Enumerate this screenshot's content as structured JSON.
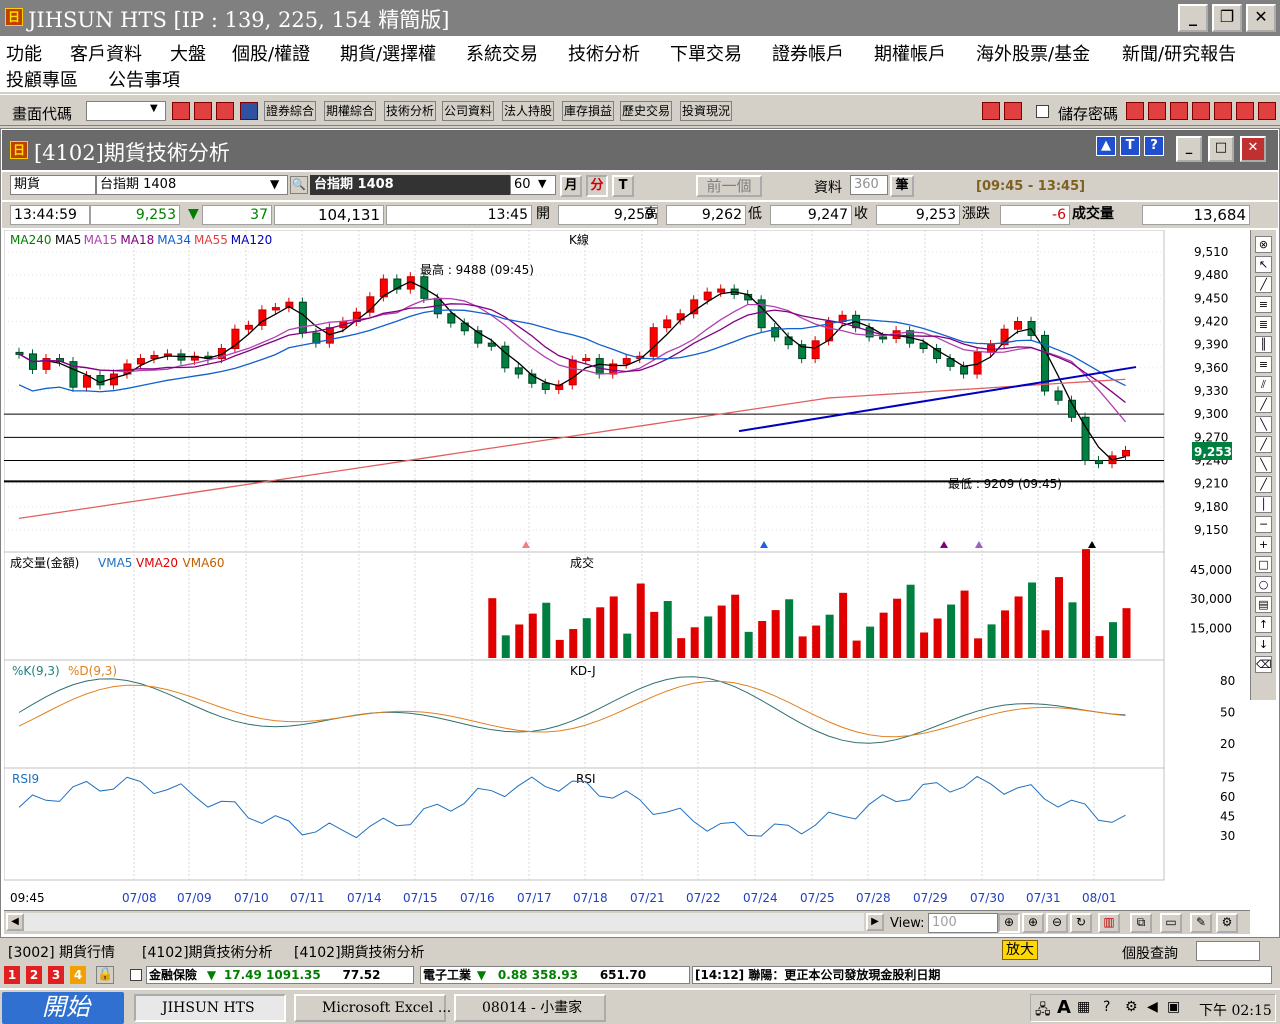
{
  "window": {
    "title": "JIHSUN HTS    [IP : 139, 225, 154 精簡版]",
    "logo": "日"
  },
  "menu": {
    "items": [
      "功能",
      "客戶資料",
      "大盤",
      "個股/權證",
      "期貨/選擇權",
      "系統交易",
      "技術分析",
      "下單交易",
      "證券帳戶",
      "期權帳戶",
      "海外股票/基金",
      "新聞/研究報告",
      "投顧專區",
      "公告事項"
    ]
  },
  "toolbar": {
    "code_label": "畫面代碼",
    "code_value": "",
    "quick_buttons": [
      "證券綜合",
      "期權綜合",
      "技術分析",
      "公司資料",
      "法人持股",
      "庫存損益",
      "歷史交易",
      "投資現況"
    ],
    "save_pwd": "儲存密碼"
  },
  "inner": {
    "title": "[4102]期貨技術分析"
  },
  "selector": {
    "market": "期貨",
    "contract": "台指期 1408",
    "contract_display": "台指期  1408",
    "period": "60",
    "btn_month": "月",
    "btn_min": "分",
    "btn_tick": "T",
    "prev": "前一個",
    "data_label": "資料",
    "data_value": "360",
    "unit": "筆",
    "range": "[09:45 - 13:45]"
  },
  "quote": {
    "time": "13:44:59",
    "price": "9,253",
    "change": "37",
    "total": "104,131",
    "bar_time": "13:45",
    "open_label": "開",
    "open": "9,259",
    "high_label": "高",
    "high": "9,262",
    "low_label": "低",
    "low": "9,247",
    "close_label": "收",
    "close": "9,253",
    "chg_label": "漲跌",
    "chg": "-6",
    "vol_label": "成交量",
    "vol": "13,684"
  },
  "chart_data": [
    {
      "type": "line",
      "title": "K線",
      "legend": [
        "MA240",
        "MA5",
        "MA15",
        "MA18",
        "MA34",
        "MA55",
        "MA120"
      ],
      "colors": {
        "MA240": "#008000",
        "MA5": "#000000",
        "MA15": "#b040b0",
        "MA18": "#800080",
        "MA34": "#1060d0",
        "MA55": "#e04040",
        "MA120": "#0000c0",
        "up": "#ff0000",
        "down": "#008040"
      },
      "ylim": [
        9150,
        9510
      ],
      "y_ticks": [
        "9,510",
        "9,480",
        "9,450",
        "9,420",
        "9,390",
        "9,360",
        "9,330",
        "9,300",
        "9,270",
        "9,240",
        "9,210",
        "9,180",
        "9,150"
      ],
      "high_note": "最高 : 9488 (09:45)",
      "low_note": "最低 : 9209 (09:45)",
      "last_price": "9,253",
      "x_labels": [
        "09:45",
        "07/08",
        "07/09",
        "07/10",
        "07/11",
        "07/14",
        "07/15",
        "07/16",
        "07/17",
        "07/18",
        "07/21",
        "07/22",
        "07/24",
        "07/25",
        "07/28",
        "07/29",
        "07/30",
        "07/31",
        "08/01"
      ]
    },
    {
      "type": "bar",
      "title": "成交",
      "legend": [
        "成交量(金額)",
        "VMA5",
        "VMA20",
        "VMA60"
      ],
      "y_ticks": [
        "45,000",
        "30,000",
        "15,000"
      ]
    },
    {
      "type": "line",
      "title": "KD-J",
      "legend": [
        "%K(9,3)",
        "%D(9,3)"
      ],
      "y_ticks": [
        "80",
        "50",
        "20"
      ]
    },
    {
      "type": "line",
      "title": "RSI",
      "legend": [
        "RSI9"
      ],
      "y_ticks": [
        "75",
        "60",
        "45",
        "30"
      ]
    }
  ],
  "scroll": {
    "view_label": "View:",
    "view_value": "100"
  },
  "tabs": [
    "[3002] 期貨行情",
    "[4102]期貨技術分析",
    "[4102]期貨技術分析"
  ],
  "zoom": "放大",
  "stock_query": "個股查詢",
  "ticker": {
    "nums": [
      "1",
      "2",
      "3",
      "4"
    ],
    "item1": "金融保險",
    "v1": "17.49 1091.35",
    "v1b": "77.52",
    "item2": "電子工業",
    "v2": "0.88 358.93",
    "v2b": "651.70",
    "news": "[14:12]  聯陽：更正本公司發放現金股利日期"
  },
  "taskbar": {
    "start": "開始",
    "tasks": [
      "JIHSUN HTS",
      "Microsoft Excel ...",
      "08014 - 小畫家"
    ],
    "clock": "下午 02:15"
  }
}
